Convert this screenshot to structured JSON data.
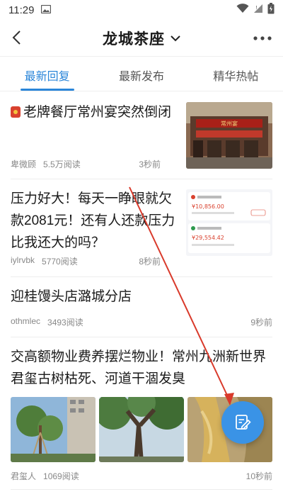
{
  "status_bar": {
    "time": "11:29"
  },
  "header": {
    "title": "龙城茶座"
  },
  "tabs": [
    {
      "label": "最新回复",
      "active": true
    },
    {
      "label": "最新发布",
      "active": false
    },
    {
      "label": "精华热帖",
      "active": false
    }
  ],
  "posts": [
    {
      "title": "老牌餐厅常州宴突然倒闭",
      "author": "卑微顾",
      "reads": "5.5万阅读",
      "time": "3秒前"
    },
    {
      "title": "压力好大！每天一睁眼就欠款2081元！还有人还款压力比我还大的吗？",
      "author": "iylrvbk",
      "reads": "5770阅读",
      "time": "8秒前"
    },
    {
      "title": "迎桂馒头店潞城分店",
      "author": "othmlec",
      "reads": "3493阅读",
      "time": "9秒前"
    },
    {
      "title": "交高额物业费养摆烂物业！常州九洲新世界君玺古树枯死、河道干涸发臭",
      "author": "君玺人",
      "reads": "1069阅读",
      "time": "10秒前"
    }
  ],
  "thumb_text": {
    "restaurant_sign": "常州宴",
    "bank1_amount": "¥10,856.00",
    "bank2_amount": "¥29,554.42"
  },
  "colors": {
    "accent": "#2b86d9",
    "fab": "#3a93e6",
    "annotation_arrow": "#d93a2b"
  }
}
